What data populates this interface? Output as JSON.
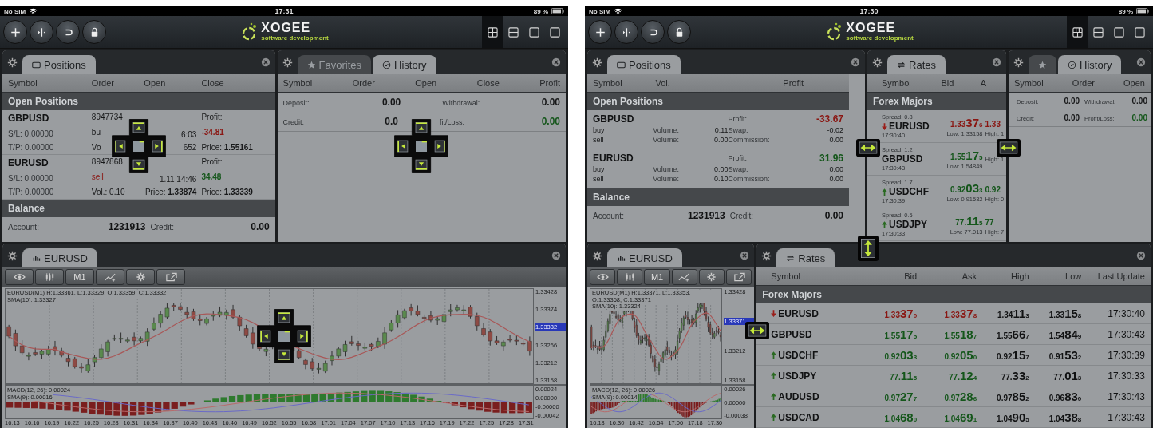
{
  "screens": [
    {
      "dock_guides": true,
      "resize_handles": false,
      "status_bar": {
        "carrier": "No SIM",
        "time": "17:31",
        "battery": "89 %"
      },
      "toolbar": {
        "buttons": [
          {
            "kind": "add"
          },
          {
            "kind": "split"
          },
          {
            "kind": "undo"
          },
          {
            "kind": "lock"
          }
        ],
        "layouts": [
          {
            "kind": "quad",
            "selected": true
          },
          {
            "kind": "rows",
            "selected": false
          },
          {
            "kind": "single",
            "selected": false
          },
          {
            "kind": "single",
            "selected": false
          }
        ]
      },
      "logo": {
        "name": "XOGEE",
        "tagline": "software development"
      },
      "rows": [
        {
          "panels": [
            {
              "kind": "positions",
              "tabs": [
                {
                  "label": "Positions",
                  "selected": true
                }
              ],
              "columns": [
                "Symbol",
                "Order",
                "Open",
                "Close"
              ],
              "section": "Open Positions",
              "rows": [
                {
                  "symbol": "GBPUSD",
                  "sl": "S/L: 0.00000",
                  "tp": "T/P: 0.00000",
                  "order": [
                    "8947734",
                    "bu",
                    "Vo"
                  ],
                  "sell": false,
                  "open": [
                    "6:03",
                    "652"
                  ],
                  "profit_label": "Profit:",
                  "profit": {
                    "text": "-34.81",
                    "color": "#8a1612"
                  },
                  "price": "Price: **1.55161**"
                },
                {
                  "symbol": "EURUSD",
                  "sl": "S/L: 0.00000",
                  "tp": "T/P: 0.00000",
                  "order": [
                    "8947868",
                    "sell",
                    "Vol.: 0.10"
                  ],
                  "sell": true,
                  "open": [
                    "1.11 14:46",
                    "Price: **1.33874**"
                  ],
                  "profit_label": "Profit:",
                  "profit": {
                    "text": "34.48",
                    "color": "#14561a"
                  },
                  "price": "Price: **1.33339**"
                }
              ],
              "balance": {
                "title": "Balance",
                "rows": [
                  {
                    "label": "Account:",
                    "value": "1231913",
                    "label2": "Credit:",
                    "value2": "0.00"
                  }
                ]
              }
            },
            {
              "kind": "history",
              "tabs": [
                {
                  "label": "Favorites",
                  "selected": false
                },
                {
                  "label": "History",
                  "selected": true
                }
              ],
              "columns": [
                "Symbol",
                "Order",
                "Open",
                "Close",
                "Profit"
              ],
              "rows": [
                {
                  "items": [
                    {
                      "label": "Deposit:",
                      "value": "0.00",
                      "color": "#161718"
                    },
                    {
                      "label": "Withdrawal:",
                      "value": "0.00",
                      "color": "#161718"
                    }
                  ]
                },
                {
                  "items": [
                    {
                      "label": "Credit:",
                      "value": "0.0",
                      "color": "#161718"
                    },
                    {
                      "label": "fit/Loss:",
                      "value": "0.00",
                      "color": "#14561a"
                    }
                  ]
                }
              ]
            }
          ]
        },
        {
          "panels": [
            {
              "kind": "chart",
              "tabs": [
                {
                  "label": "EURUSD",
                  "selected": true
                }
              ],
              "tools": [
                {
                  "kind": "eye"
                },
                {
                  "kind": "candles"
                },
                {
                  "kind": "text",
                  "label": "M1"
                },
                {
                  "kind": "indicator"
                },
                {
                  "kind": "gear"
                },
                {
                  "kind": "share"
                }
              ],
              "legend": [
                "EURUSD(M1) H:1.33361, L:1.33329, O:1.33359, C:1.33332",
                "SMA(10): 1.33327"
              ],
              "price_ticks": [
                {
                  "label": "1.33428",
                  "current": false
                },
                {
                  "label": "1.33374",
                  "current": false
                },
                {
                  "label": "1.33332",
                  "current": true
                },
                {
                  "label": "1.33266",
                  "current": false
                },
                {
                  "label": "1.33212",
                  "current": false
                },
                {
                  "label": "1.33158",
                  "current": false
                }
              ],
              "macd_legend": [
                "MACD(12, 26): 0.00024",
                "SMA(9): 0.00016"
              ],
              "macd_ticks": [
                "0.00024",
                "0.00000",
                "-0.00000",
                "-0.00042"
              ],
              "time_ticks": [
                "16:13",
                "16:16",
                "16:19",
                "16:22",
                "16:25",
                "16:28",
                "16:31",
                "16:34",
                "16:37",
                "16:40",
                "16:43",
                "16:46",
                "16:49",
                "16:52",
                "16:55",
                "16:58",
                "17:01",
                "17:04",
                "17:07",
                "17:10",
                "17:13",
                "17:16",
                "17:19",
                "17:22",
                "17:25",
                "17:28",
                "17:31"
              ]
            }
          ]
        }
      ]
    },
    {
      "dock_guides": false,
      "resize_handles": true,
      "status_bar": {
        "carrier": "No SIM",
        "time": "17:30",
        "battery": "89 %"
      },
      "toolbar": {
        "buttons": [
          {
            "kind": "add"
          },
          {
            "kind": "split"
          },
          {
            "kind": "undo"
          },
          {
            "kind": "lock"
          }
        ],
        "layouts": [
          {
            "kind": "grid",
            "selected": true
          },
          {
            "kind": "rows",
            "selected": false
          },
          {
            "kind": "single",
            "selected": false
          },
          {
            "kind": "single",
            "selected": false
          }
        ]
      },
      "logo": {
        "name": "XOGEE",
        "tagline": "software development"
      },
      "rows": [
        {
          "panels": [
            {
              "kind": "positions-summary",
              "tabs": [
                {
                  "label": "Positions",
                  "selected": true
                }
              ],
              "columns": [
                "Symbol",
                "Vol.",
                "Profit"
              ],
              "section": "Open Positions",
              "rows": [
                {
                  "symbol": "GBPUSD",
                  "sides": [
                    "buy",
                    "sell"
                  ],
                  "volumes": [
                    {
                      "label": "Volume:",
                      "value": "0.11"
                    },
                    {
                      "label": "Volume:",
                      "value": "0.00"
                    }
                  ],
                  "profit": {
                    "label": "Profit:",
                    "value": "-33.67",
                    "color": "#8a1612"
                  },
                  "stats": [
                    {
                      "label": "Swap:",
                      "value": "-0.02"
                    },
                    {
                      "label": "Commission:",
                      "value": "0.00"
                    }
                  ]
                },
                {
                  "symbol": "EURUSD",
                  "sides": [
                    "buy",
                    "sell"
                  ],
                  "volumes": [
                    {
                      "label": "Volume:",
                      "value": "0.00"
                    },
                    {
                      "label": "Volume:",
                      "value": "0.10"
                    }
                  ],
                  "profit": {
                    "label": "Profit:",
                    "value": "31.96",
                    "color": "#14561a"
                  },
                  "stats": [
                    {
                      "label": "Swap:",
                      "value": "0.00"
                    },
                    {
                      "label": "Commission:",
                      "value": "0.00"
                    }
                  ]
                }
              ],
              "balance": {
                "title": "Balance",
                "rows": [
                  {
                    "label": "Account:",
                    "value": "1231913",
                    "label2": "Credit:",
                    "value2": "0.00"
                  }
                ]
              }
            },
            {
              "kind": "rates-tiles",
              "tabs": [
                {
                  "label": "Rates",
                  "selected": true
                }
              ],
              "columns": [
                "Symbol",
                "Bid",
                "A"
              ],
              "section": "Forex Majors",
              "rows": [
                {
                  "spread": "Spread: 0.8",
                  "symbol": "EURUSD",
                  "rising": false,
                  "arrow": true,
                  "time": "17:30:40",
                  "bid": {
                    "pre": "1.33",
                    "big": "37",
                    "post": "6"
                  },
                  "low": "Low: 1.33158",
                  "ask": "1.33",
                  "high": "High: 1"
                },
                {
                  "spread": "Spread: 1.2",
                  "symbol": "GBPUSD",
                  "rising": true,
                  "arrow": false,
                  "time": "17:30:43",
                  "bid": {
                    "pre": "1.55",
                    "big": "17",
                    "post": "5"
                  },
                  "low": "Low: 1.54849",
                  "high": "High: 1"
                },
                {
                  "spread": "Spread: 1.7",
                  "symbol": "USDCHF",
                  "rising": true,
                  "arrow": true,
                  "time": "17:30:39",
                  "bid": {
                    "pre": "0.92",
                    "big": "03",
                    "post": "3"
                  },
                  "low": "Low: 0.91532",
                  "ask": "0.92",
                  "high": "High: 0"
                },
                {
                  "spread": "Spread: 0.5",
                  "symbol": "USDJPY",
                  "rising": true,
                  "arrow": true,
                  "time": "17:30:33",
                  "bid": {
                    "pre": "77.",
                    "big": "11",
                    "post": "5"
                  },
                  "low": "Low: 77.013",
                  "ask": "77",
                  "high": "High: 7"
                }
              ]
            },
            {
              "kind": "history-summary",
              "tabs": [
                {
                  "selected": false
                },
                {
                  "label": "History",
                  "selected": true
                }
              ],
              "columns": [
                "Symbol",
                "Order",
                "Open"
              ],
              "rows": [
                {
                  "items": [
                    {
                      "label": "Deposit:",
                      "value": "0.00",
                      "color": "#161718"
                    },
                    {
                      "label": "Withdrawal:",
                      "value": "0.00",
                      "color": "#161718"
                    }
                  ]
                },
                {
                  "items": [
                    {
                      "label": "Credit:",
                      "value": "0.00",
                      "color": "#161718"
                    },
                    {
                      "label": "Profit/Loss:",
                      "value": "0.00",
                      "color": "#14561a"
                    }
                  ]
                }
              ]
            }
          ]
        },
        {
          "panels": [
            {
              "kind": "chart",
              "tabs": [
                {
                  "label": "EURUSD",
                  "selected": true
                }
              ],
              "tools": [
                {
                  "kind": "eye"
                },
                {
                  "kind": "candles"
                },
                {
                  "kind": "text",
                  "label": "M1"
                },
                {
                  "kind": "indicator"
                },
                {
                  "kind": "gear"
                },
                {
                  "kind": "share"
                }
              ],
              "legend": [
                "EURUSD(M1) H:1.33371, L:1.33353, O:1.33368, C:1.33371",
                "SMA(10): 1.33324"
              ],
              "price_ticks": [
                {
                  "label": "1.33428",
                  "current": false
                },
                {
                  "label": "1.33371",
                  "current": true
                },
                {
                  "label": "1.33212",
                  "current": false
                },
                {
                  "label": "1.33158",
                  "current": false
                }
              ],
              "macd_legend": [
                "MACD(12, 26): 0.00026",
                "SMA(9): 0.00014"
              ],
              "macd_ticks": [
                "0.00026",
                "0.00000",
                "-0.00038"
              ],
              "time_ticks": [
                "16:18",
                "16:30",
                "16:42",
                "16:54",
                "17:06",
                "17:18",
                "17:30"
              ]
            },
            {
              "kind": "rates",
              "tabs": [
                {
                  "label": "Rates",
                  "selected": true
                }
              ],
              "columns": [
                "Symbol",
                "Bid",
                "Ask",
                "High",
                "Low",
                "Last Update"
              ],
              "section": "Forex Majors",
              "rows": [
                {
                  "symbol": "EURUSD",
                  "rising": false,
                  "arrow": true,
                  "bid": {
                    "pre": "1.33",
                    "big": "37",
                    "post": "0"
                  },
                  "ask": {
                    "pre": "1.33",
                    "big": "37",
                    "post": "8"
                  },
                  "high": {
                    "pre": "1.34",
                    "big": "11",
                    "post": "3"
                  },
                  "low": {
                    "pre": "1.33",
                    "big": "15",
                    "post": "8"
                  },
                  "time": "17:30:40"
                },
                {
                  "symbol": "GBPUSD",
                  "rising": true,
                  "arrow": false,
                  "bid": {
                    "pre": "1.55",
                    "big": "17",
                    "post": "5"
                  },
                  "ask": {
                    "pre": "1.55",
                    "big": "18",
                    "post": "7"
                  },
                  "high": {
                    "pre": "1.55",
                    "big": "66",
                    "post": "7"
                  },
                  "low": {
                    "pre": "1.54",
                    "big": "84",
                    "post": "9"
                  },
                  "time": "17:30:43"
                },
                {
                  "symbol": "USDCHF",
                  "rising": true,
                  "arrow": true,
                  "bid": {
                    "pre": "0.92",
                    "big": "03",
                    "post": "3"
                  },
                  "ask": {
                    "pre": "0.92",
                    "big": "05",
                    "post": "0"
                  },
                  "high": {
                    "pre": "0.92",
                    "big": "15",
                    "post": "7"
                  },
                  "low": {
                    "pre": "0.91",
                    "big": "53",
                    "post": "2"
                  },
                  "time": "17:30:39"
                },
                {
                  "symbol": "USDJPY",
                  "rising": true,
                  "arrow": true,
                  "bid": {
                    "pre": "77.",
                    "big": "11",
                    "post": "5"
                  },
                  "ask": {
                    "pre": "77.",
                    "big": "12",
                    "post": "4"
                  },
                  "high": {
                    "pre": "77.",
                    "big": "33",
                    "post": "2"
                  },
                  "low": {
                    "pre": "77.",
                    "big": "01",
                    "post": "3"
                  },
                  "time": "17:30:33"
                },
                {
                  "symbol": "AUDUSD",
                  "rising": true,
                  "arrow": true,
                  "bid": {
                    "pre": "0.97",
                    "big": "27",
                    "post": "7"
                  },
                  "ask": {
                    "pre": "0.97",
                    "big": "28",
                    "post": "6"
                  },
                  "high": {
                    "pre": "0.97",
                    "big": "85",
                    "post": "2"
                  },
                  "low": {
                    "pre": "0.96",
                    "big": "83",
                    "post": "0"
                  },
                  "time": "17:30:43"
                },
                {
                  "symbol": "USDCAD",
                  "rising": true,
                  "arrow": true,
                  "bid": {
                    "pre": "1.04",
                    "big": "68",
                    "post": "0"
                  },
                  "ask": {
                    "pre": "1.04",
                    "big": "69",
                    "post": "1"
                  },
                  "high": {
                    "pre": "1.04",
                    "big": "90",
                    "post": "5"
                  },
                  "low": {
                    "pre": "1.04",
                    "big": "38",
                    "post": "8"
                  },
                  "time": "17:30:43"
                }
              ]
            }
          ]
        }
      ]
    }
  ]
}
